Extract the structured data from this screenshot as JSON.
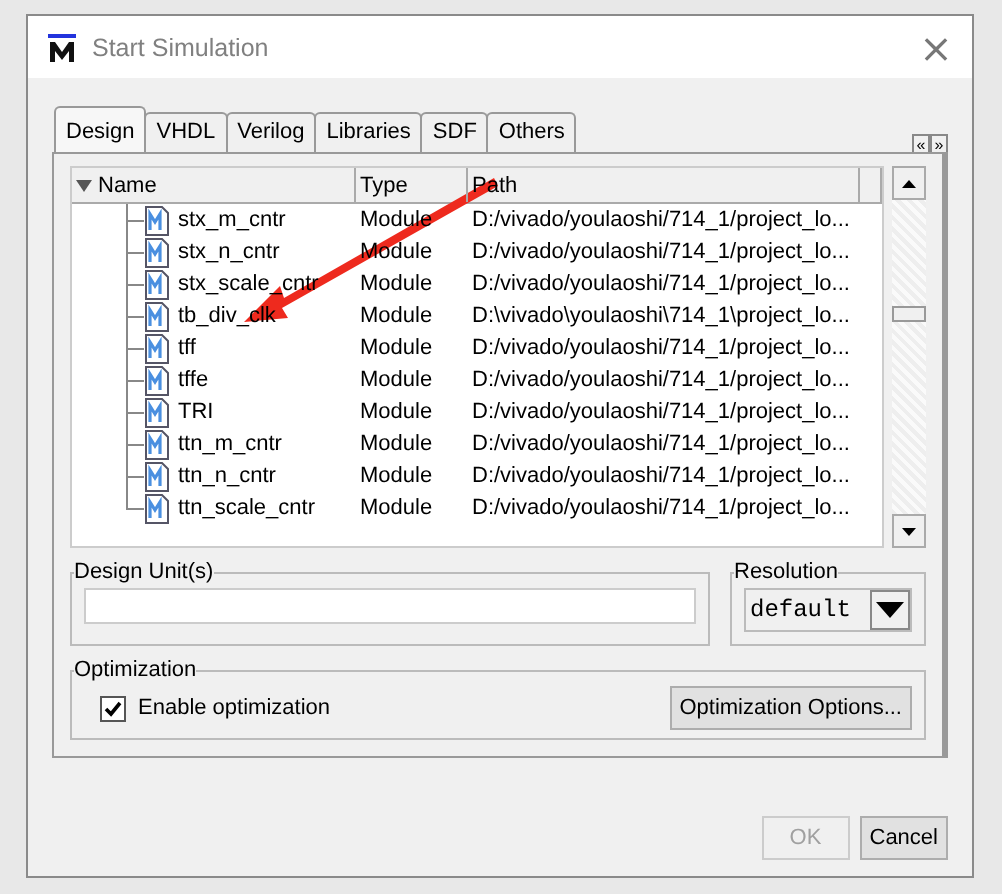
{
  "window": {
    "title": "Start Simulation",
    "close": "×"
  },
  "tabs": [
    {
      "label": "Design",
      "selected": true
    },
    {
      "label": "VHDL",
      "selected": false
    },
    {
      "label": "Verilog",
      "selected": false
    },
    {
      "label": "Libraries",
      "selected": false
    },
    {
      "label": "SDF",
      "selected": false
    },
    {
      "label": "Others",
      "selected": false
    }
  ],
  "tab_scroll": [
    "«",
    "»"
  ],
  "table": {
    "columns": [
      "Name",
      "Type",
      "Path"
    ],
    "rows": [
      {
        "name": "stx_m_cntr",
        "type": "Module",
        "path": "D:/vivado/youlaoshi/714_1/project_lo..."
      },
      {
        "name": "stx_n_cntr",
        "type": "Module",
        "path": "D:/vivado/youlaoshi/714_1/project_lo..."
      },
      {
        "name": "stx_scale_cntr",
        "type": "Module",
        "path": "D:/vivado/youlaoshi/714_1/project_lo..."
      },
      {
        "name": "tb_div_clk",
        "type": "Module",
        "path": "D:\\vivado\\youlaoshi\\714_1\\project_lo..."
      },
      {
        "name": "tff",
        "type": "Module",
        "path": "D:/vivado/youlaoshi/714_1/project_lo..."
      },
      {
        "name": "tffe",
        "type": "Module",
        "path": "D:/vivado/youlaoshi/714_1/project_lo..."
      },
      {
        "name": "TRI",
        "type": "Module",
        "path": "D:/vivado/youlaoshi/714_1/project_lo..."
      },
      {
        "name": "ttn_m_cntr",
        "type": "Module",
        "path": "D:/vivado/youlaoshi/714_1/project_lo..."
      },
      {
        "name": "ttn_n_cntr",
        "type": "Module",
        "path": "D:/vivado/youlaoshi/714_1/project_lo..."
      },
      {
        "name": "ttn_scale_cntr",
        "type": "Module",
        "path": "D:/vivado/youlaoshi/714_1/project_lo..."
      }
    ]
  },
  "design_units": {
    "label": "Design Unit(s)"
  },
  "resolution": {
    "label": "Resolution",
    "value": "default"
  },
  "optimization": {
    "label": "Optimization",
    "enable": {
      "label": "Enable optimization",
      "checked": true
    },
    "options_button": "Optimization Options..."
  },
  "buttons": [
    {
      "label": "OK",
      "disabled": true
    },
    {
      "label": "Cancel",
      "disabled": false
    }
  ]
}
